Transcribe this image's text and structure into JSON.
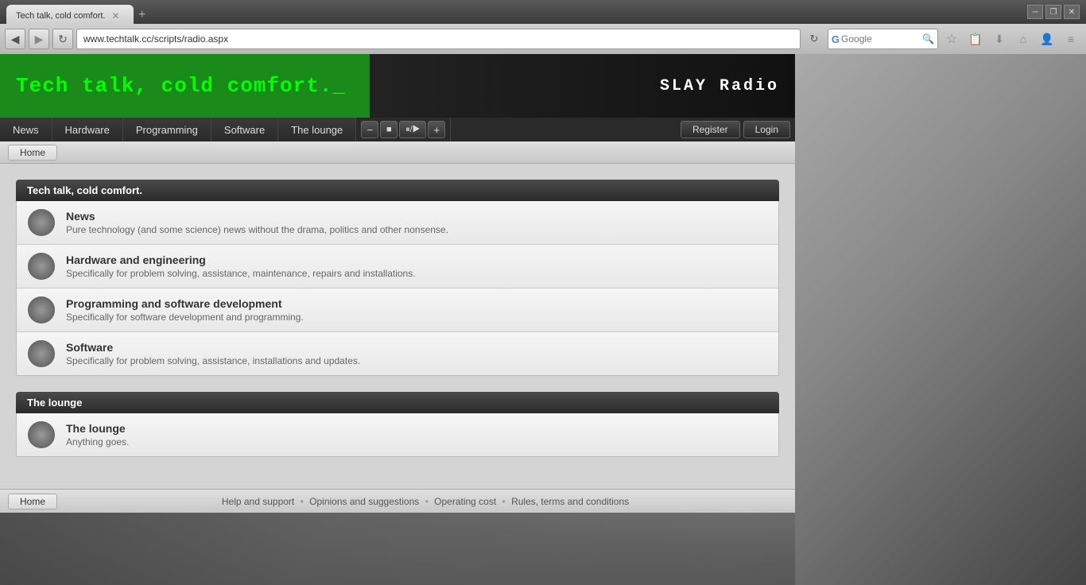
{
  "browser": {
    "tab_title": "Tech talk, cold comfort.",
    "url": "www.techtalk.cc/scripts/radio.aspx",
    "search_placeholder": "Google"
  },
  "header": {
    "title": "Tech talk, cold comfort._",
    "radio_label": "SLAY Radio"
  },
  "nav": {
    "items": [
      {
        "label": "News",
        "id": "news"
      },
      {
        "label": "Hardware",
        "id": "hardware"
      },
      {
        "label": "Programming",
        "id": "programming"
      },
      {
        "label": "Software",
        "id": "software"
      },
      {
        "label": "The lounge",
        "id": "lounge"
      }
    ],
    "radio_controls": [
      {
        "label": "−",
        "id": "minus"
      },
      {
        "label": "■",
        "id": "stop"
      },
      {
        "label": "⏸/▶",
        "id": "playpause"
      },
      {
        "label": "+",
        "id": "plus"
      }
    ],
    "register_label": "Register",
    "login_label": "Login"
  },
  "breadcrumb": {
    "home_label": "Home"
  },
  "sections": [
    {
      "id": "tech-talk",
      "header": "Tech talk, cold comfort.",
      "forums": [
        {
          "id": "news",
          "title": "News",
          "description": "Pure technology (and some science) news without the drama, politics and other nonsense."
        },
        {
          "id": "hardware",
          "title": "Hardware and engineering",
          "description": "Specifically for problem solving, assistance, maintenance, repairs and installations."
        },
        {
          "id": "programming",
          "title": "Programming and software development",
          "description": "Specifically for software development and programming."
        },
        {
          "id": "software",
          "title": "Software",
          "description": "Specifically for problem solving, assistance, installations and updates."
        }
      ]
    },
    {
      "id": "lounge",
      "header": "The lounge",
      "forums": [
        {
          "id": "thelounge",
          "title": "The lounge",
          "description": "Anything goes."
        }
      ]
    }
  ],
  "footer": {
    "home_label": "Home",
    "links": [
      {
        "label": "Help and support",
        "id": "help"
      },
      {
        "label": "Opinions and suggestions",
        "id": "opinions"
      },
      {
        "label": "Operating cost",
        "id": "cost"
      },
      {
        "label": "Rules, terms and conditions",
        "id": "rules"
      }
    ]
  }
}
